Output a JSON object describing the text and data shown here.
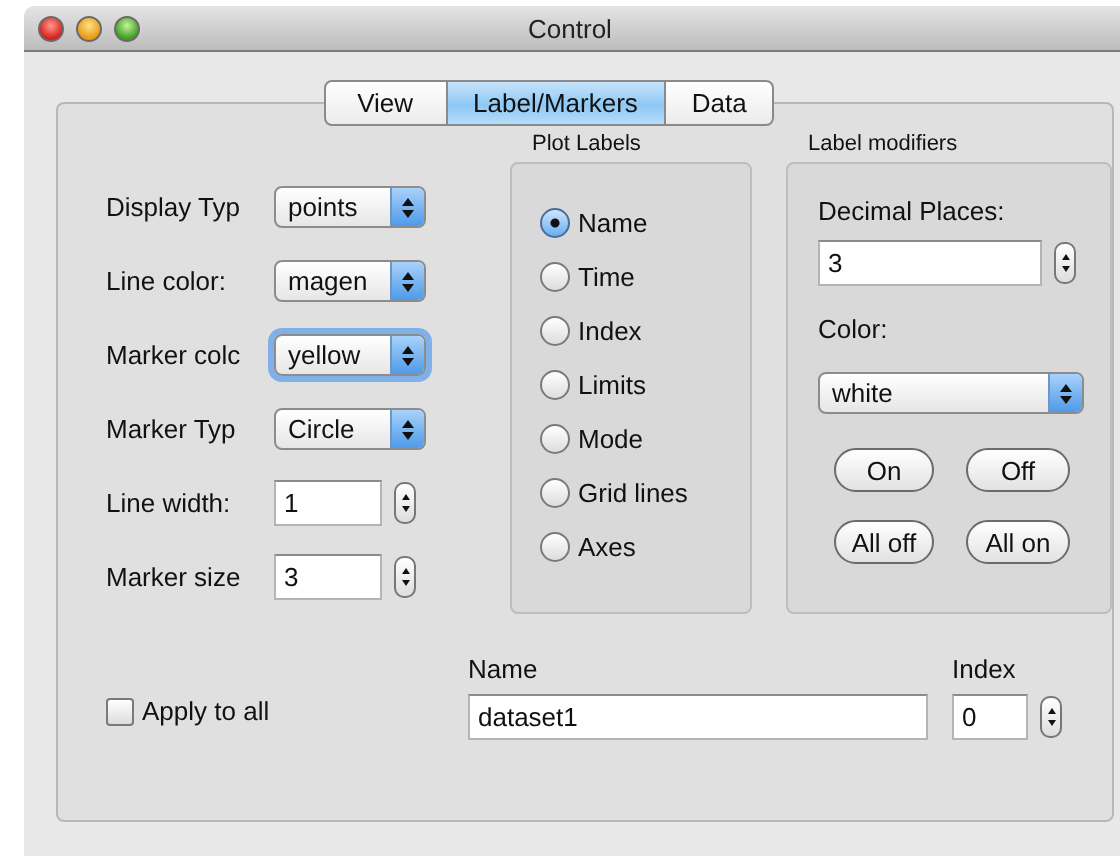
{
  "window": {
    "title": "Control"
  },
  "tabs": [
    {
      "label": "View",
      "selected": false
    },
    {
      "label": "Label/Markers",
      "selected": true
    },
    {
      "label": "Data",
      "selected": false
    }
  ],
  "settings": [
    {
      "kind": "popup",
      "label": "Display Typ",
      "value": "points",
      "focused": false
    },
    {
      "kind": "popup",
      "label": "Line color:",
      "value": "magen",
      "focused": false
    },
    {
      "kind": "popup",
      "label": "Marker colc",
      "value": "yellow",
      "focused": true
    },
    {
      "kind": "popup",
      "label": "Marker Typ",
      "value": "Circle",
      "focused": false
    },
    {
      "kind": "stepper",
      "label": "Line width:",
      "value": "1",
      "focused": false
    },
    {
      "kind": "stepper",
      "label": "Marker size",
      "value": "3",
      "focused": false
    }
  ],
  "plot_labels": {
    "title": "Plot Labels",
    "options": [
      {
        "label": "Name",
        "selected": true
      },
      {
        "label": "Time",
        "selected": false
      },
      {
        "label": "Index",
        "selected": false
      },
      {
        "label": "Limits",
        "selected": false
      },
      {
        "label": "Mode",
        "selected": false
      },
      {
        "label": "Grid lines",
        "selected": false
      },
      {
        "label": "Axes",
        "selected": false
      }
    ]
  },
  "label_modifiers": {
    "title": "Label modifiers",
    "decimal_places_label": "Decimal Places:",
    "decimal_places": "3",
    "color_label": "Color:",
    "color_choice": "white",
    "buttons": [
      "On",
      "Off",
      "All off",
      "All on"
    ]
  },
  "apply_to_all": {
    "label": "Apply to all",
    "checked": false
  },
  "name": {
    "label": "Name",
    "value": "dataset1"
  },
  "index": {
    "label": "Index",
    "value": "0"
  }
}
